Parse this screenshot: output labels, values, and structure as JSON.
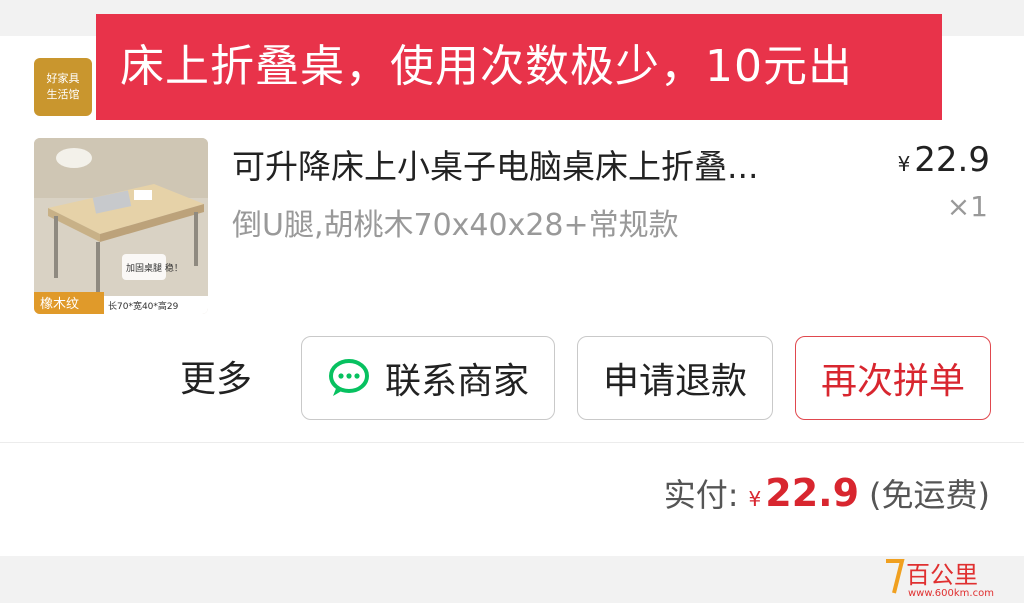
{
  "overlay": {
    "text": "床上折叠桌，使用次数极少，10元出"
  },
  "shop": {
    "logo_line1": "好家具",
    "logo_line2": "生活馆"
  },
  "product": {
    "title": "可升降床上小桌子电脑桌床上折叠...",
    "spec": "倒U腿,胡桃木70x40x28+常规款",
    "currency": "¥",
    "price": "22.9",
    "quantity": "×1",
    "thumb_labels": {
      "material": "橡木纹",
      "size": "长70*宽40*高29",
      "note": "加固桌腿 稳！"
    }
  },
  "actions": {
    "more": "更多",
    "contact": "联系商家",
    "refund": "申请退款",
    "reorder": "再次拼单"
  },
  "payment": {
    "label": "实付:",
    "currency": "¥",
    "amount": "22.9",
    "shipping": "(免运费)"
  },
  "watermark": {
    "brand": "百公里",
    "url": "www.600km.com"
  },
  "colors": {
    "accent": "#d8262f",
    "banner": "#e8334a",
    "wechat_green": "#07c160"
  }
}
